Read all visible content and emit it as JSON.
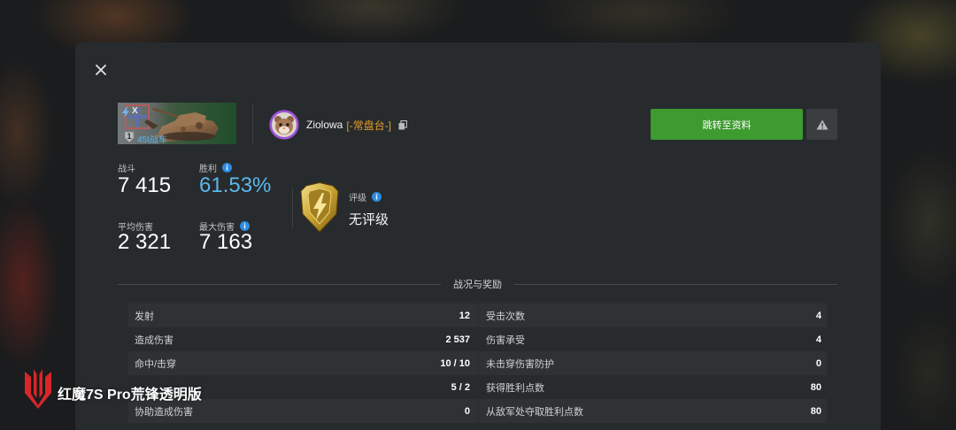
{
  "tank": {
    "tier": "X",
    "mastery_level": "1",
    "name": "45t战车"
  },
  "player": {
    "name": "Ziolowa",
    "clan_tag": "[-常盘台-]"
  },
  "actions": {
    "profile_button": "跳转至资料"
  },
  "stats": {
    "battles": {
      "label": "战斗",
      "value": "7 415"
    },
    "win_rate": {
      "label": "胜利",
      "value": "61.53%"
    },
    "avg_damage": {
      "label": "平均伤害",
      "value": "2 321"
    },
    "max_damage": {
      "label": "最大伤害",
      "value": "7 163"
    },
    "rating": {
      "label": "评级",
      "value": "无评级"
    }
  },
  "section": {
    "title": "战况与奖励"
  },
  "table": {
    "left": [
      {
        "label": "发射",
        "value": "12"
      },
      {
        "label": "造成伤害",
        "value": "2 537"
      },
      {
        "label": "命中/击穿",
        "value": "10 / 10"
      },
      {
        "value": "5 / 2"
      },
      {
        "label": "协助造成伤害",
        "value": "0"
      }
    ],
    "right": [
      {
        "label": "受击次数",
        "value": "4"
      },
      {
        "label": "伤害承受",
        "value": "4"
      },
      {
        "label": "未击穿伤害防护",
        "value": "0"
      },
      {
        "label": "获得胜利点数",
        "value": "80"
      },
      {
        "label": "从敌军处夺取胜利点数",
        "value": "80"
      }
    ]
  },
  "watermark": {
    "text": "红魔7S Pro荒锋透明版"
  },
  "icons": [
    "close-icon",
    "lightning-icon",
    "nation-flag-icon",
    "tank-image",
    "mastery-badge-icon",
    "avatar-hamster",
    "copy-icon",
    "warning-icon",
    "info-icon",
    "rating-badge-icon",
    "red-magic-logo"
  ],
  "colors": {
    "panel": "#272b2d",
    "accent_green": "#3d9b2f",
    "win_rate_blue": "#5cb6ea",
    "clan_orange": "#e39b2c",
    "info_blue": "#2d8be0",
    "avatar_ring": "#9b52d6"
  }
}
